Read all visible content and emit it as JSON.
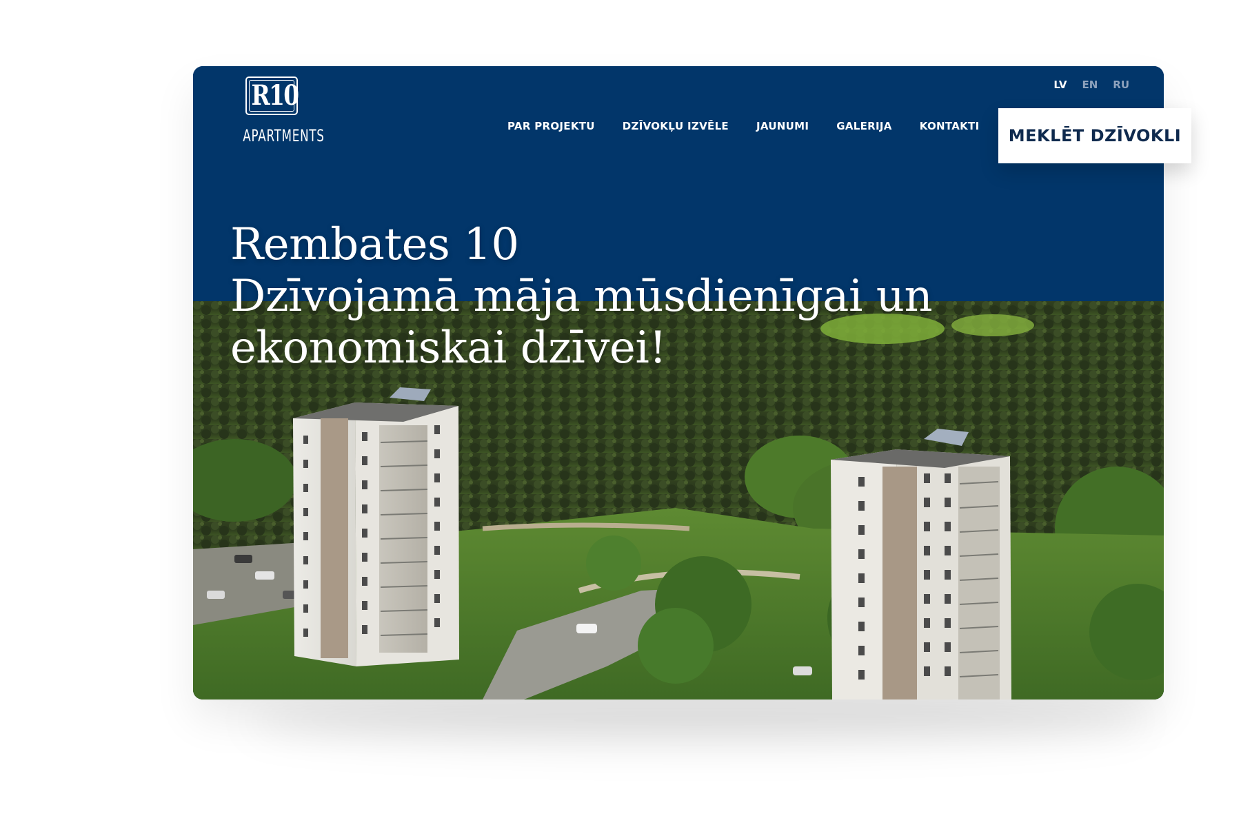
{
  "logo": {
    "mark": "R10",
    "word": "APARTMENTS"
  },
  "languages": [
    {
      "code": "LV",
      "active": true
    },
    {
      "code": "EN",
      "active": false
    },
    {
      "code": "RU",
      "active": false
    }
  ],
  "nav": {
    "items": [
      {
        "label": "PAR PROJEKTU"
      },
      {
        "label": "DZĪVOKĻU IZVĒLE"
      },
      {
        "label": "JAUNUMI"
      },
      {
        "label": "GALERIJA"
      },
      {
        "label": "KONTAKTI"
      }
    ],
    "cta_label": "MEKLĒT DZĪVOKLI"
  },
  "hero": {
    "line1": "Rembates 10",
    "line2": "Dzīvojamā māja mūsdienīgai un",
    "line3": "ekonomiskai dzīvei!"
  },
  "colors": {
    "navy": "#02366a",
    "cta_text": "#0f2a4e",
    "white": "#ffffff"
  }
}
